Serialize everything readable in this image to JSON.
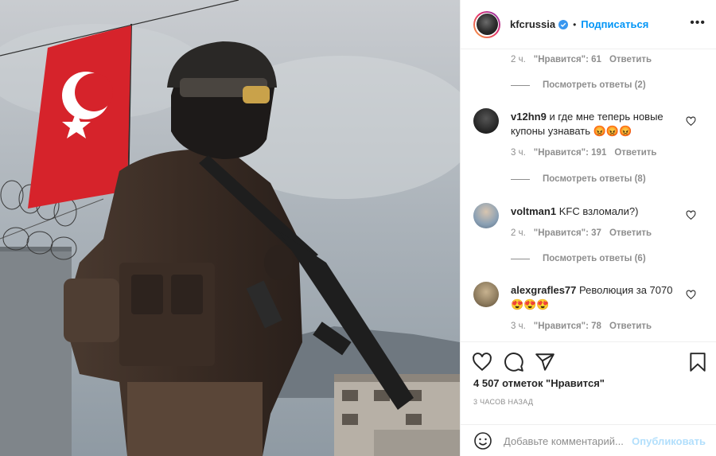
{
  "post": {
    "username": "kfcrussia",
    "follow_label": "Подписаться",
    "separator": "•"
  },
  "comments_feed": {
    "top_meta": {
      "time": "2 ч.",
      "likes": "\"Нравится\": 61",
      "reply": "Ответить"
    },
    "top_view_replies": "Посмотреть ответы (2)",
    "items": [
      {
        "username": "v12hn9",
        "text": "и где мне теперь новые купоны узнавать",
        "emojis": "😡😡😡",
        "time": "3 ч.",
        "likes": "\"Нравится\": 191",
        "reply": "Ответить",
        "view_replies": "Посмотреть ответы (8)"
      },
      {
        "username": "voltman1",
        "text": "KFC взломали?)",
        "time": "2 ч.",
        "likes": "\"Нравится\": 37",
        "reply": "Ответить",
        "view_replies": "Посмотреть ответы (6)"
      },
      {
        "username": "alexgrafles77",
        "text": "Революция за 7070",
        "emojis": "😍😍😍",
        "time": "3 ч.",
        "likes": "\"Нравится\": 78",
        "reply": "Ответить"
      }
    ]
  },
  "actions": {
    "likes_count": "4 507 отметок \"Нравится\"",
    "posted_ago": "3 ЧАСОВ НАЗАД"
  },
  "add_comment": {
    "placeholder": "Добавьте комментарий...",
    "post_label": "Опубликовать"
  },
  "colors": {
    "link_blue": "#0095f6",
    "muted": "#8e8e8e",
    "verified": "#3897f0",
    "flag_red": "#d6232b"
  },
  "icons": [
    "verified-badge-icon",
    "more-options-icon",
    "heart-icon",
    "comment-icon",
    "share-icon",
    "bookmark-icon",
    "smile-icon"
  ]
}
